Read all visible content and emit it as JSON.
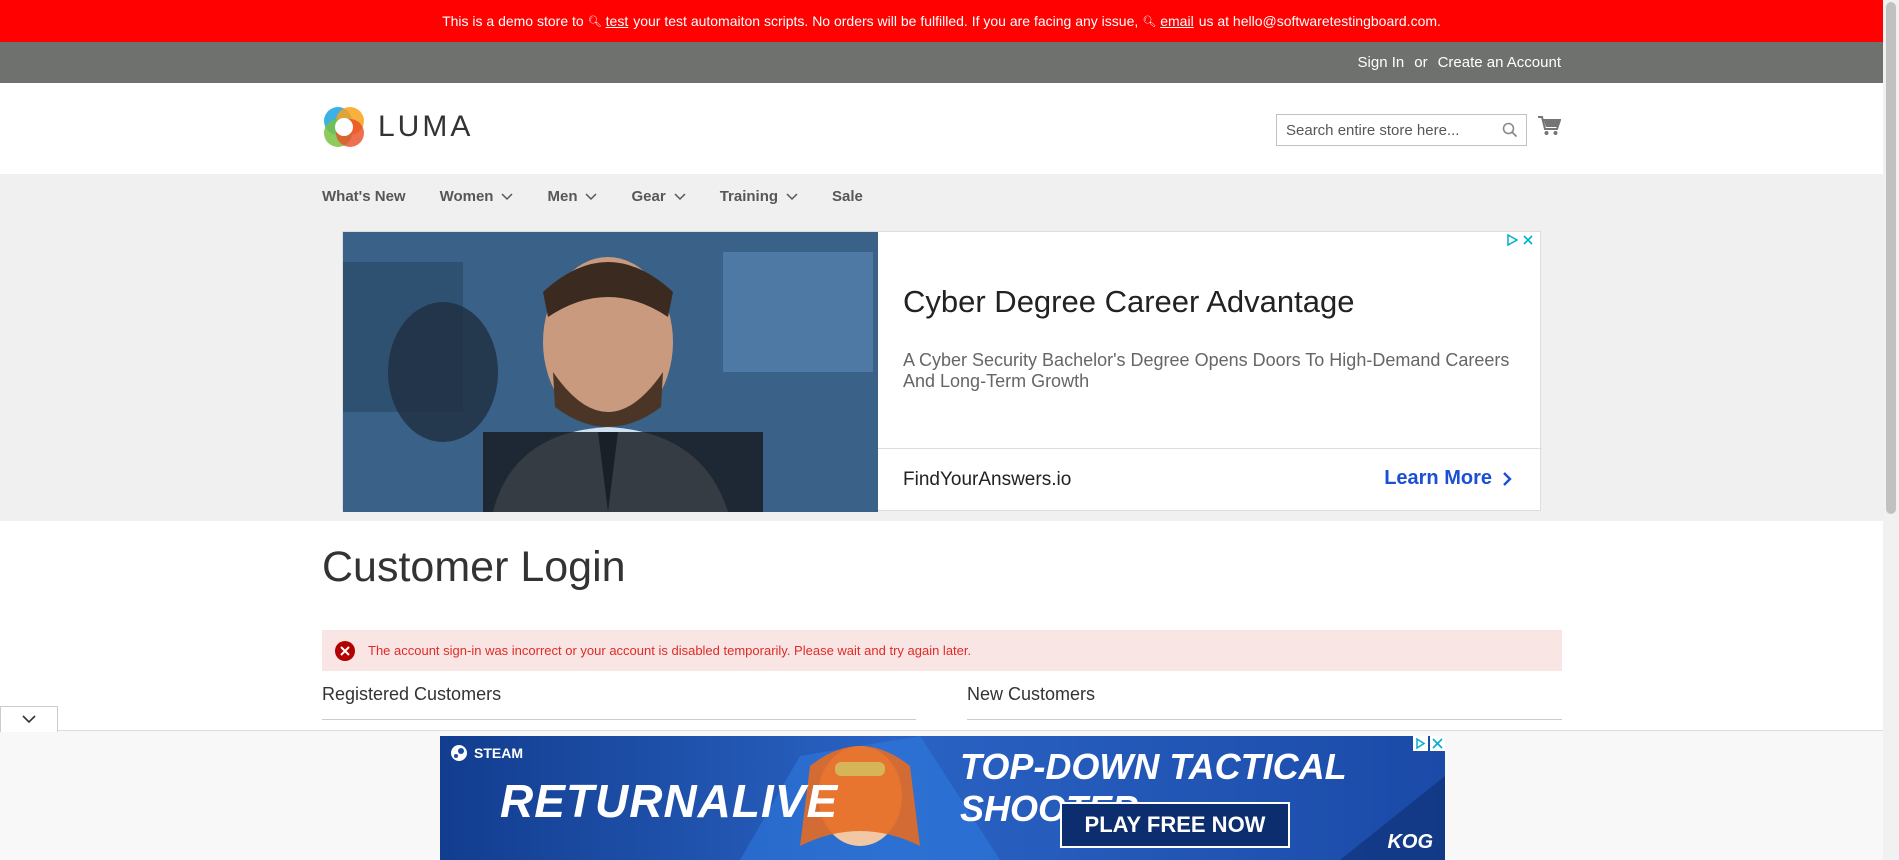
{
  "demo_notice": {
    "text_1": "This is a demo store to",
    "link_1": "test",
    "text_2": "your test automaiton scripts. No orders will be fulfilled. If you are facing any issue,",
    "link_2": "email",
    "text_3": "us at hello@softwaretestingboard.com."
  },
  "header_links": {
    "sign_in": "Sign In",
    "or": "or",
    "create_account": "Create an Account"
  },
  "brand": {
    "name": "LUMA"
  },
  "search": {
    "placeholder": "Search entire store here..."
  },
  "nav": {
    "items": [
      {
        "label": "What's New",
        "has_submenu": false
      },
      {
        "label": "Women",
        "has_submenu": true
      },
      {
        "label": "Men",
        "has_submenu": true
      },
      {
        "label": "Gear",
        "has_submenu": true
      },
      {
        "label": "Training",
        "has_submenu": true
      },
      {
        "label": "Sale",
        "has_submenu": false
      }
    ]
  },
  "ad": {
    "title": "Cyber Degree Career Advantage",
    "subtitle": "A Cyber Security Bachelor's Degree Opens Doors To High-Demand Careers And Long-Term Growth",
    "domain": "FindYourAnswers.io",
    "cta": "Learn More"
  },
  "page": {
    "title": "Customer Login"
  },
  "error": {
    "message": "The account sign-in was incorrect or your account is disabled temporarily. Please wait and try again later."
  },
  "blocks": {
    "registered": "Registered Customers",
    "new": "New Customers"
  },
  "bottom_ad": {
    "platform": "STEAM",
    "game": "RETURNALIVE",
    "tagline": "TOP-DOWN TACTICAL SHOOTER",
    "cta": "PLAY FREE NOW",
    "publisher": "KOG"
  },
  "colors": {
    "demo_bar": "#ff0101",
    "panel_header": "#6e716e",
    "nav_bg": "#f0f0f0",
    "error_bg": "#fae5e5",
    "error_text": "#e02b27",
    "link_blue": "#1a4fd6"
  }
}
